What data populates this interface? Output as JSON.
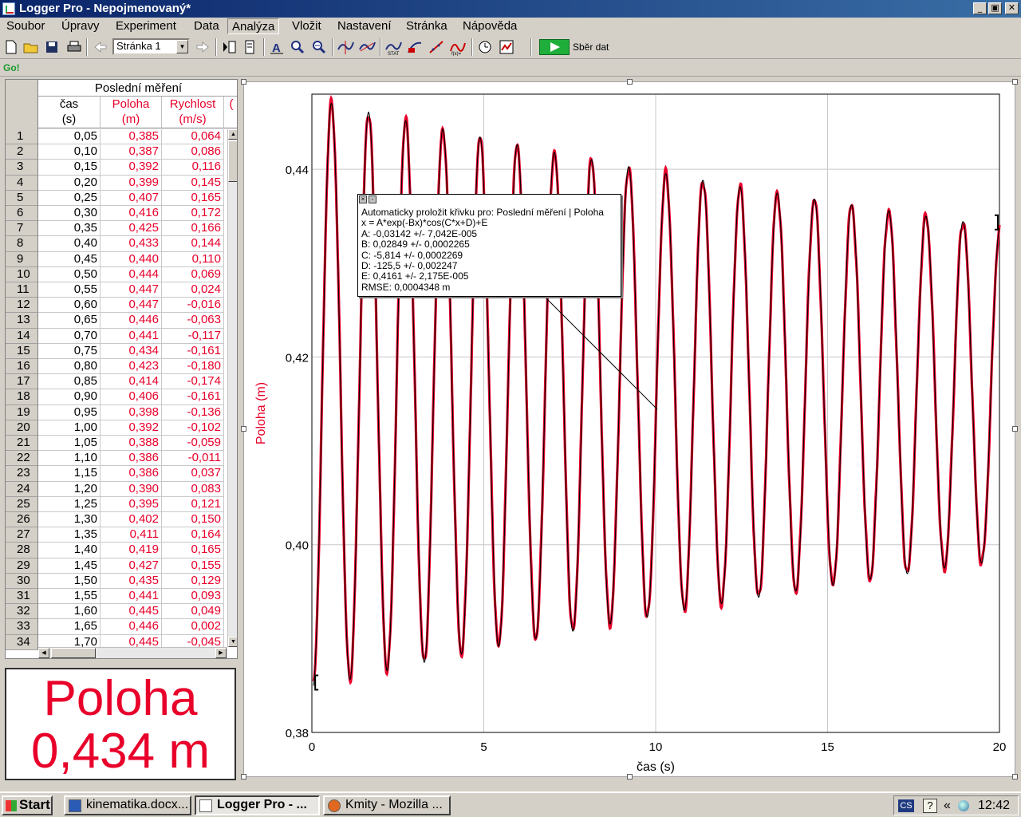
{
  "window": {
    "title": "Logger Pro - Nepojmenovaný*",
    "min": "_",
    "max": "▣",
    "close": "✕"
  },
  "menu": [
    "Soubor",
    "Úpravy",
    "Experiment",
    "Data",
    "Analýza",
    "Vložit",
    "Nastavení",
    "Stránka",
    "Nápověda"
  ],
  "toolbar": {
    "page_select": "Stránka 1",
    "collect_label": "Sběr dat"
  },
  "go_label": "Go!",
  "table": {
    "dataset": "Poslední měření",
    "columns": [
      {
        "name": "čas",
        "unit": "(s)",
        "color": "#000000"
      },
      {
        "name": "Poloha",
        "unit": "(m)",
        "color": "#e8002a"
      },
      {
        "name": "Rychlost",
        "unit": "(m/s)",
        "color": "#e8002a"
      },
      {
        "name": "(",
        "unit": "",
        "color": "#e8002a"
      }
    ],
    "rows": [
      [
        "1",
        "0,05",
        "0,385",
        "0,064"
      ],
      [
        "2",
        "0,10",
        "0,387",
        "0,086"
      ],
      [
        "3",
        "0,15",
        "0,392",
        "0,116"
      ],
      [
        "4",
        "0,20",
        "0,399",
        "0,145"
      ],
      [
        "5",
        "0,25",
        "0,407",
        "0,165"
      ],
      [
        "6",
        "0,30",
        "0,416",
        "0,172"
      ],
      [
        "7",
        "0,35",
        "0,425",
        "0,166"
      ],
      [
        "8",
        "0,40",
        "0,433",
        "0,144"
      ],
      [
        "9",
        "0,45",
        "0,440",
        "0,110"
      ],
      [
        "10",
        "0,50",
        "0,444",
        "0,069"
      ],
      [
        "11",
        "0,55",
        "0,447",
        "0,024"
      ],
      [
        "12",
        "0,60",
        "0,447",
        "-0,016"
      ],
      [
        "13",
        "0,65",
        "0,446",
        "-0,063"
      ],
      [
        "14",
        "0,70",
        "0,441",
        "-0,117"
      ],
      [
        "15",
        "0,75",
        "0,434",
        "-0,161"
      ],
      [
        "16",
        "0,80",
        "0,423",
        "-0,180"
      ],
      [
        "17",
        "0,85",
        "0,414",
        "-0,174"
      ],
      [
        "18",
        "0,90",
        "0,406",
        "-0,161"
      ],
      [
        "19",
        "0,95",
        "0,398",
        "-0,136"
      ],
      [
        "20",
        "1,00",
        "0,392",
        "-0,102"
      ],
      [
        "21",
        "1,05",
        "0,388",
        "-0,059"
      ],
      [
        "22",
        "1,10",
        "0,386",
        "-0,011"
      ],
      [
        "23",
        "1,15",
        "0,386",
        "0,037"
      ],
      [
        "24",
        "1,20",
        "0,390",
        "0,083"
      ],
      [
        "25",
        "1,25",
        "0,395",
        "0,121"
      ],
      [
        "26",
        "1,30",
        "0,402",
        "0,150"
      ],
      [
        "27",
        "1,35",
        "0,411",
        "0,164"
      ],
      [
        "28",
        "1,40",
        "0,419",
        "0,165"
      ],
      [
        "29",
        "1,45",
        "0,427",
        "0,155"
      ],
      [
        "30",
        "1,50",
        "0,435",
        "0,129"
      ],
      [
        "31",
        "1,55",
        "0,441",
        "0,093"
      ],
      [
        "32",
        "1,60",
        "0,445",
        "0,049"
      ],
      [
        "33",
        "1,65",
        "0,446",
        "0,002"
      ],
      [
        "34",
        "1,70",
        "0,445",
        "-0,045"
      ]
    ]
  },
  "meter": {
    "label": "Poloha",
    "value": "0,434 m",
    "color": "#e8002a"
  },
  "graph": {
    "xlabel": "čas (s)",
    "ylabel": "Poloha (m)",
    "xlim": [
      0,
      20
    ],
    "ylim": [
      0.38,
      0.448
    ],
    "xticks": [
      "0",
      "5",
      "10",
      "15",
      "20"
    ],
    "yticks": [
      "0,38",
      "0,40",
      "0,42",
      "0,44"
    ],
    "data_color": "#e8002a",
    "fit_color": "#000000"
  },
  "chart_data": {
    "type": "line",
    "title": "",
    "xlabel": "čas (s)",
    "ylabel": "Poloha (m)",
    "xlim": [
      0,
      20
    ],
    "ylim": [
      0.38,
      0.448
    ],
    "grid": true,
    "series": [
      {
        "name": "Poloha",
        "model": "x = A*exp(-Bx)*cos(C*x+D)+E",
        "A": -0.03142,
        "B": 0.02849,
        "C": -5.814,
        "D": -125.5,
        "E": 0.4161,
        "x_start": 0.05,
        "x_end": 20.0,
        "x_step": 0.05
      }
    ]
  },
  "fit": {
    "lines": [
      "Automaticky proložit křivku pro: Poslední měření | Poloha",
      "x = A*exp(-Bx)*cos(C*x+D)+E",
      "A: -0,03142 +/- 7,042E-005",
      "B: 0,02849 +/- 0,0002265",
      "C: -5,814 +/- 0,0002269",
      "D: -125,5 +/- 0,002247",
      "E: 0,4161 +/- 2,175E-005",
      "RMSE: 0,0004348 m"
    ]
  },
  "taskbar": {
    "start": "Start",
    "tasks": [
      "kinematika.docx...",
      "Logger Pro - ...",
      "Kmity - Mozilla ..."
    ],
    "tray_lang": "CS",
    "tray_help": "?",
    "tray_chevron": "«",
    "clock": "12:42"
  }
}
